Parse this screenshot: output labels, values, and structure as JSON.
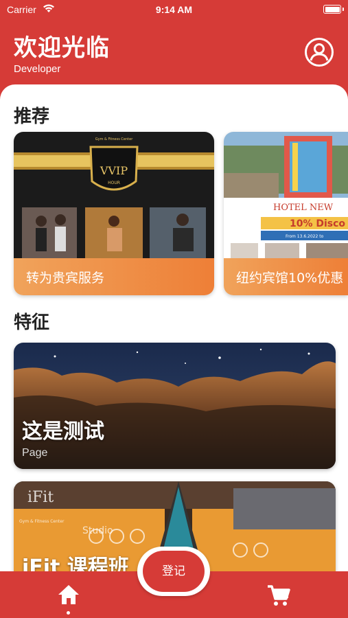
{
  "status_bar": {
    "carrier": "Carrier",
    "time": "9:14 AM"
  },
  "header": {
    "title": "欢迎光临",
    "subtitle": "Developer"
  },
  "sections": {
    "recommended": {
      "title": "推荐",
      "cards": [
        {
          "label": "转为贵宾服务",
          "image_text": [
            "VVIP",
            "HOUR",
            "Gym & Fitness Center"
          ]
        },
        {
          "label": "纽约宾馆10%优惠",
          "image_text": [
            "HOTEL NEW",
            "10% Disco",
            "From 13.6.2022 to"
          ]
        }
      ]
    },
    "featured": {
      "title": "特征",
      "cards": [
        {
          "title": "这是测试",
          "subtitle": "Page"
        },
        {
          "title": "iFit 课程班",
          "image_text": [
            "Gym & Fitness Center",
            "Studio",
            "iFit"
          ]
        }
      ]
    }
  },
  "tab_bar": {
    "register_label": "登记"
  },
  "colors": {
    "primary": "#d63b37",
    "card_gradient_start": "#f0a35b",
    "card_gradient_end": "#ee7f37"
  }
}
